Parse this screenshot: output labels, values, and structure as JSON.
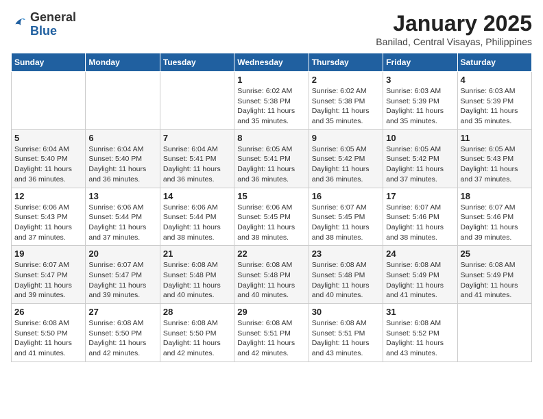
{
  "header": {
    "logo_general": "General",
    "logo_blue": "Blue",
    "title": "January 2025",
    "subtitle": "Banilad, Central Visayas, Philippines"
  },
  "weekdays": [
    "Sunday",
    "Monday",
    "Tuesday",
    "Wednesday",
    "Thursday",
    "Friday",
    "Saturday"
  ],
  "weeks": [
    [
      {
        "day": "",
        "info": ""
      },
      {
        "day": "",
        "info": ""
      },
      {
        "day": "",
        "info": ""
      },
      {
        "day": "1",
        "info": "Sunrise: 6:02 AM\nSunset: 5:38 PM\nDaylight: 11 hours and 35 minutes."
      },
      {
        "day": "2",
        "info": "Sunrise: 6:02 AM\nSunset: 5:38 PM\nDaylight: 11 hours and 35 minutes."
      },
      {
        "day": "3",
        "info": "Sunrise: 6:03 AM\nSunset: 5:39 PM\nDaylight: 11 hours and 35 minutes."
      },
      {
        "day": "4",
        "info": "Sunrise: 6:03 AM\nSunset: 5:39 PM\nDaylight: 11 hours and 35 minutes."
      }
    ],
    [
      {
        "day": "5",
        "info": "Sunrise: 6:04 AM\nSunset: 5:40 PM\nDaylight: 11 hours and 36 minutes."
      },
      {
        "day": "6",
        "info": "Sunrise: 6:04 AM\nSunset: 5:40 PM\nDaylight: 11 hours and 36 minutes."
      },
      {
        "day": "7",
        "info": "Sunrise: 6:04 AM\nSunset: 5:41 PM\nDaylight: 11 hours and 36 minutes."
      },
      {
        "day": "8",
        "info": "Sunrise: 6:05 AM\nSunset: 5:41 PM\nDaylight: 11 hours and 36 minutes."
      },
      {
        "day": "9",
        "info": "Sunrise: 6:05 AM\nSunset: 5:42 PM\nDaylight: 11 hours and 36 minutes."
      },
      {
        "day": "10",
        "info": "Sunrise: 6:05 AM\nSunset: 5:42 PM\nDaylight: 11 hours and 37 minutes."
      },
      {
        "day": "11",
        "info": "Sunrise: 6:05 AM\nSunset: 5:43 PM\nDaylight: 11 hours and 37 minutes."
      }
    ],
    [
      {
        "day": "12",
        "info": "Sunrise: 6:06 AM\nSunset: 5:43 PM\nDaylight: 11 hours and 37 minutes."
      },
      {
        "day": "13",
        "info": "Sunrise: 6:06 AM\nSunset: 5:44 PM\nDaylight: 11 hours and 37 minutes."
      },
      {
        "day": "14",
        "info": "Sunrise: 6:06 AM\nSunset: 5:44 PM\nDaylight: 11 hours and 38 minutes."
      },
      {
        "day": "15",
        "info": "Sunrise: 6:06 AM\nSunset: 5:45 PM\nDaylight: 11 hours and 38 minutes."
      },
      {
        "day": "16",
        "info": "Sunrise: 6:07 AM\nSunset: 5:45 PM\nDaylight: 11 hours and 38 minutes."
      },
      {
        "day": "17",
        "info": "Sunrise: 6:07 AM\nSunset: 5:46 PM\nDaylight: 11 hours and 38 minutes."
      },
      {
        "day": "18",
        "info": "Sunrise: 6:07 AM\nSunset: 5:46 PM\nDaylight: 11 hours and 39 minutes."
      }
    ],
    [
      {
        "day": "19",
        "info": "Sunrise: 6:07 AM\nSunset: 5:47 PM\nDaylight: 11 hours and 39 minutes."
      },
      {
        "day": "20",
        "info": "Sunrise: 6:07 AM\nSunset: 5:47 PM\nDaylight: 11 hours and 39 minutes."
      },
      {
        "day": "21",
        "info": "Sunrise: 6:08 AM\nSunset: 5:48 PM\nDaylight: 11 hours and 40 minutes."
      },
      {
        "day": "22",
        "info": "Sunrise: 6:08 AM\nSunset: 5:48 PM\nDaylight: 11 hours and 40 minutes."
      },
      {
        "day": "23",
        "info": "Sunrise: 6:08 AM\nSunset: 5:48 PM\nDaylight: 11 hours and 40 minutes."
      },
      {
        "day": "24",
        "info": "Sunrise: 6:08 AM\nSunset: 5:49 PM\nDaylight: 11 hours and 41 minutes."
      },
      {
        "day": "25",
        "info": "Sunrise: 6:08 AM\nSunset: 5:49 PM\nDaylight: 11 hours and 41 minutes."
      }
    ],
    [
      {
        "day": "26",
        "info": "Sunrise: 6:08 AM\nSunset: 5:50 PM\nDaylight: 11 hours and 41 minutes."
      },
      {
        "day": "27",
        "info": "Sunrise: 6:08 AM\nSunset: 5:50 PM\nDaylight: 11 hours and 42 minutes."
      },
      {
        "day": "28",
        "info": "Sunrise: 6:08 AM\nSunset: 5:50 PM\nDaylight: 11 hours and 42 minutes."
      },
      {
        "day": "29",
        "info": "Sunrise: 6:08 AM\nSunset: 5:51 PM\nDaylight: 11 hours and 42 minutes."
      },
      {
        "day": "30",
        "info": "Sunrise: 6:08 AM\nSunset: 5:51 PM\nDaylight: 11 hours and 43 minutes."
      },
      {
        "day": "31",
        "info": "Sunrise: 6:08 AM\nSunset: 5:52 PM\nDaylight: 11 hours and 43 minutes."
      },
      {
        "day": "",
        "info": ""
      }
    ]
  ]
}
